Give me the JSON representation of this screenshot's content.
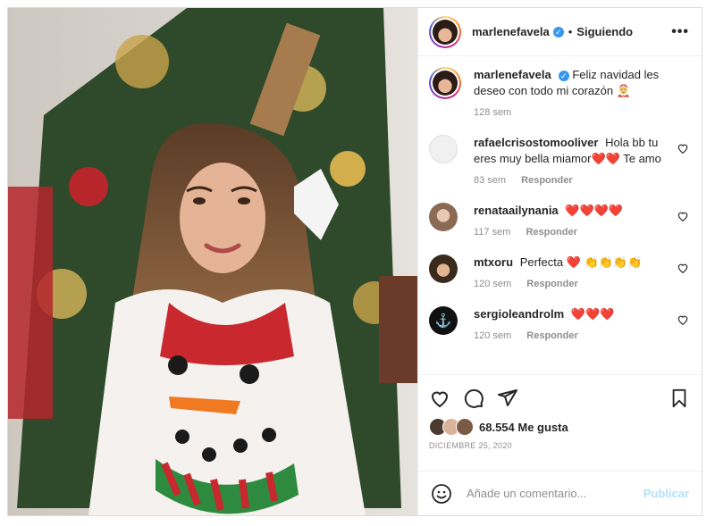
{
  "post": {
    "username": "marlenefavela",
    "follow_status": "Siguiendo",
    "separator": "•",
    "more": "•••",
    "caption": "Feliz navidad les deseo con todo mi corazón 🤶",
    "caption_time": "128 sem"
  },
  "comments": [
    {
      "user": "rafaelcrisostomooliver",
      "text": "Hola bb tu eres muy bella miamor❤️❤️ Te amo",
      "time": "83 sem",
      "reply": "Responder"
    },
    {
      "user": "renataailynania",
      "text": "❤️❤️❤️❤️",
      "time": "117 sem",
      "reply": "Responder"
    },
    {
      "user": "mtxoru",
      "text": "Perfecta ❤️ 👏👏👏👏",
      "time": "120 sem",
      "reply": "Responder"
    },
    {
      "user": "sergioleandrolm",
      "text": "❤️❤️❤️",
      "time": "120 sem",
      "reply": "Responder"
    }
  ],
  "likes_text": "68.554 Me gusta",
  "date": "DICIEMBRE 25, 2020",
  "comment_input": {
    "placeholder": "Añade un comentario..."
  },
  "publish_label": "Publicar",
  "icons": [
    "heart-icon",
    "comment-icon",
    "share-icon",
    "bookmark-icon",
    "emoji-icon",
    "more-icon",
    "verified-icon"
  ],
  "colors": {
    "accent": "#3897f0",
    "publish_disabled": "#b2dffc",
    "muted": "#8e8e8e",
    "heart_red": "#ed4956"
  }
}
